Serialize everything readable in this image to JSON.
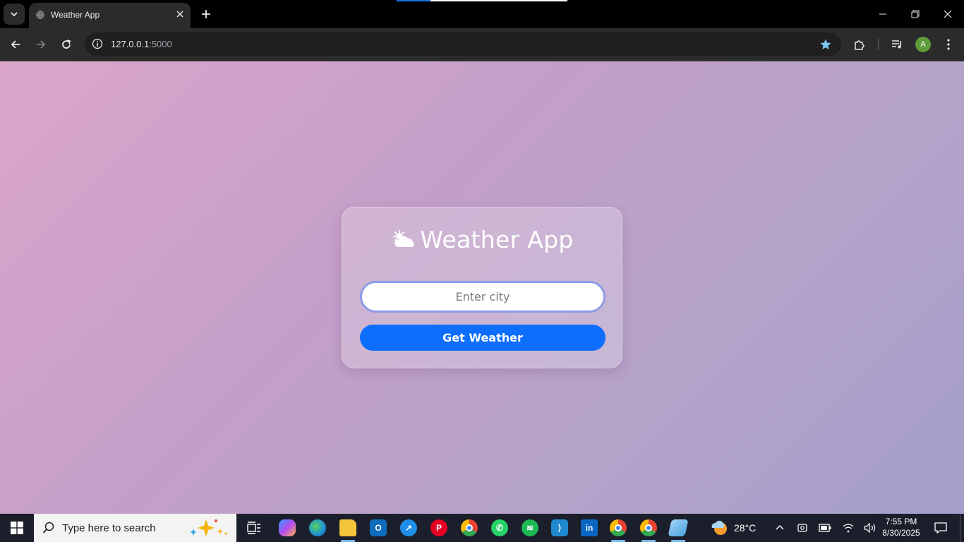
{
  "browser": {
    "tab": {
      "title": "Weather App"
    },
    "address": {
      "host": "127.0.0.1",
      "port": ":5000"
    },
    "profile_initial": "A"
  },
  "page": {
    "title": "Weather App",
    "title_icon": "sun-behind-cloud-icon",
    "city_input": {
      "placeholder": "Enter city",
      "value": ""
    },
    "button_label": "Get Weather",
    "colors": {
      "button": "#0d6efd",
      "input_border": "#8f9be6",
      "gradient_start": "#dca6cb",
      "gradient_end": "#a49fca"
    }
  },
  "taskbar": {
    "search_placeholder": "Type here to search",
    "pinned_apps": [
      "task-view",
      "copilot",
      "edge",
      "file-explorer",
      "outlook",
      "safari",
      "pinterest",
      "chrome",
      "whatsapp",
      "spotify",
      "vscode",
      "linkedin",
      "chrome-profile-a",
      "chrome-profile-b",
      "notepad"
    ],
    "weather": {
      "temperature": "28°C"
    },
    "clock": {
      "time": "7:55 PM",
      "date": "8/30/2025"
    }
  }
}
